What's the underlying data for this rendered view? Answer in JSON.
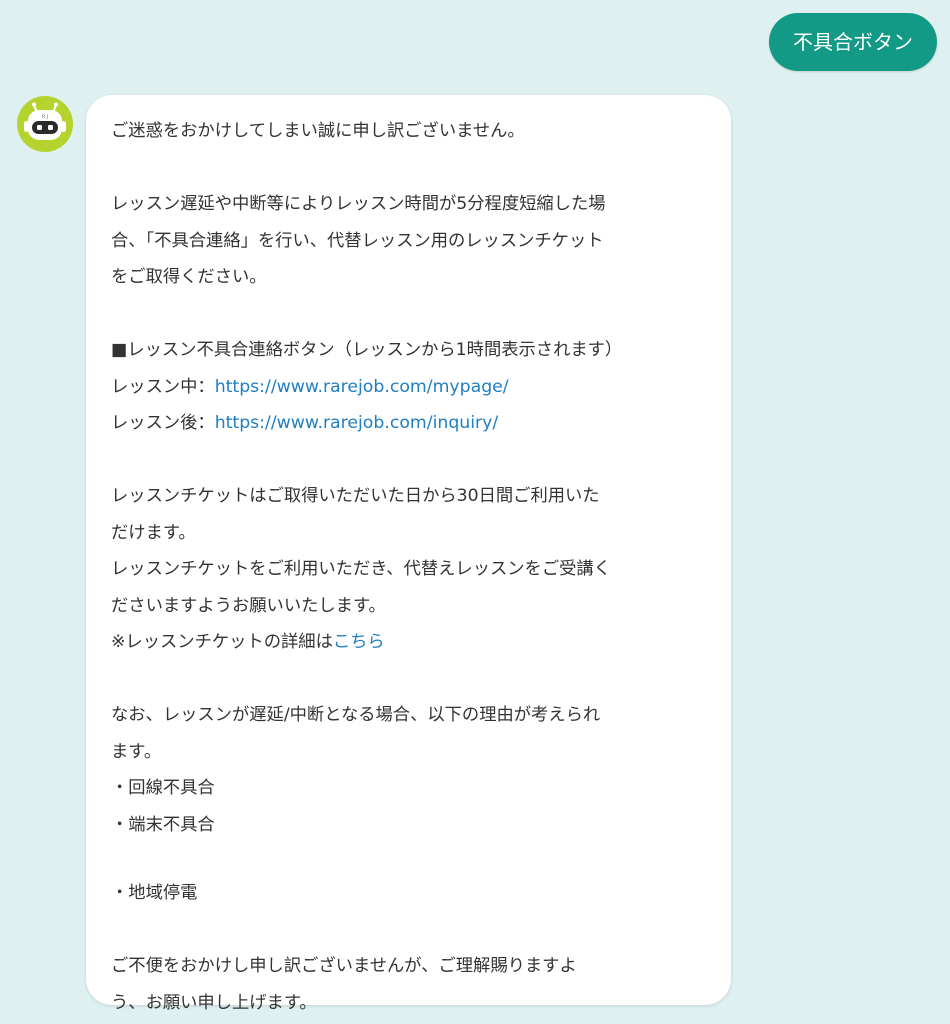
{
  "user_message": {
    "text": "不具合ボタン"
  },
  "bot": {
    "avatar_text": "R J",
    "colors": {
      "avatar_bg": "#b5d32d",
      "bubble_bg": "#ffffff",
      "user_bubble_bg": "#139a86",
      "link": "#1f7fc2",
      "page_bg": "#def0ef"
    },
    "message": {
      "apology": "ご迷惑をおかけしてしまい誠に申し訳ございません。",
      "intro_1": "レッスン遅延や中断等によりレッスン時間が5分程度短縮した場",
      "intro_2": "合、「不具合連絡」を行い、代替レッスン用のレッスンチケット",
      "intro_3": "をご取得ください。",
      "button_heading": "■レッスン不具合連絡ボタン（レッスンから1時間表示されます）",
      "during_label": "レッスン中：",
      "during_link": "https://www.rarejob.com/mypage/",
      "after_label": "レッスン後：",
      "after_link": "https://www.rarejob.com/inquiry/",
      "ticket_1": "レッスンチケットはご取得いただいた日から30日間ご利用いた",
      "ticket_2": "だけます。",
      "ticket_3": "レッスンチケットをご利用いただき、代替えレッスンをご受講く",
      "ticket_4": "ださいますようお願いいたします。",
      "ticket_detail_prefix": "※レッスンチケットの詳細は",
      "ticket_detail_link": "こちら",
      "reasons_intro_1": "なお、レッスンが遅延/中断となる場合、以下の理由が考えられ",
      "reasons_intro_2": "ます。",
      "reason_1": "・回線不具合",
      "reason_2": "・端末不具合",
      "reason_3": "・地域停電",
      "closing_1": "ご不便をおかけし申し訳ございませんが、ご理解賜りますよ",
      "closing_2": "う、お願い申し上げます。"
    }
  }
}
